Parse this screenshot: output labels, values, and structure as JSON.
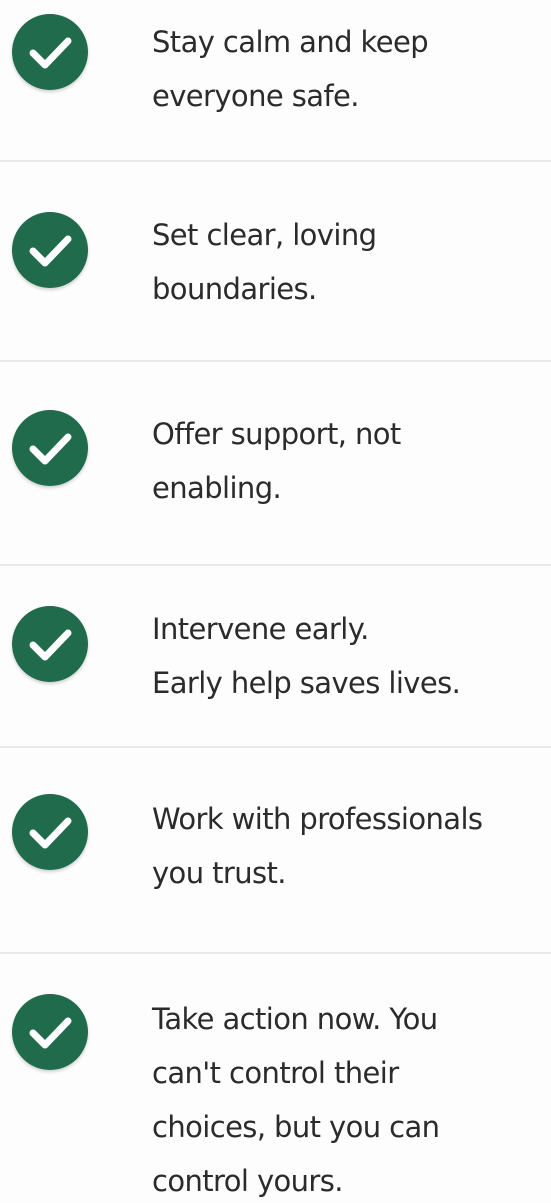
{
  "theme": {
    "check_color": "#1f6b4c",
    "text_color": "#2b2b2b",
    "divider_color": "#e9ebea"
  },
  "icons": {
    "check": "check-circle-icon"
  },
  "items": [
    {
      "lines": [
        "Stay calm and keep",
        "everyone safe."
      ]
    },
    {
      "lines": [
        "Set clear, loving",
        "boundaries."
      ]
    },
    {
      "lines": [
        "Offer support, not",
        "enabling."
      ]
    },
    {
      "lines": [
        "Intervene early.",
        "Early help saves lives."
      ]
    },
    {
      "lines": [
        "Work with professionals",
        "you trust."
      ]
    },
    {
      "lines": [
        "Take action now. You",
        "can't control their",
        "choices, but you can",
        "control yours."
      ]
    }
  ]
}
